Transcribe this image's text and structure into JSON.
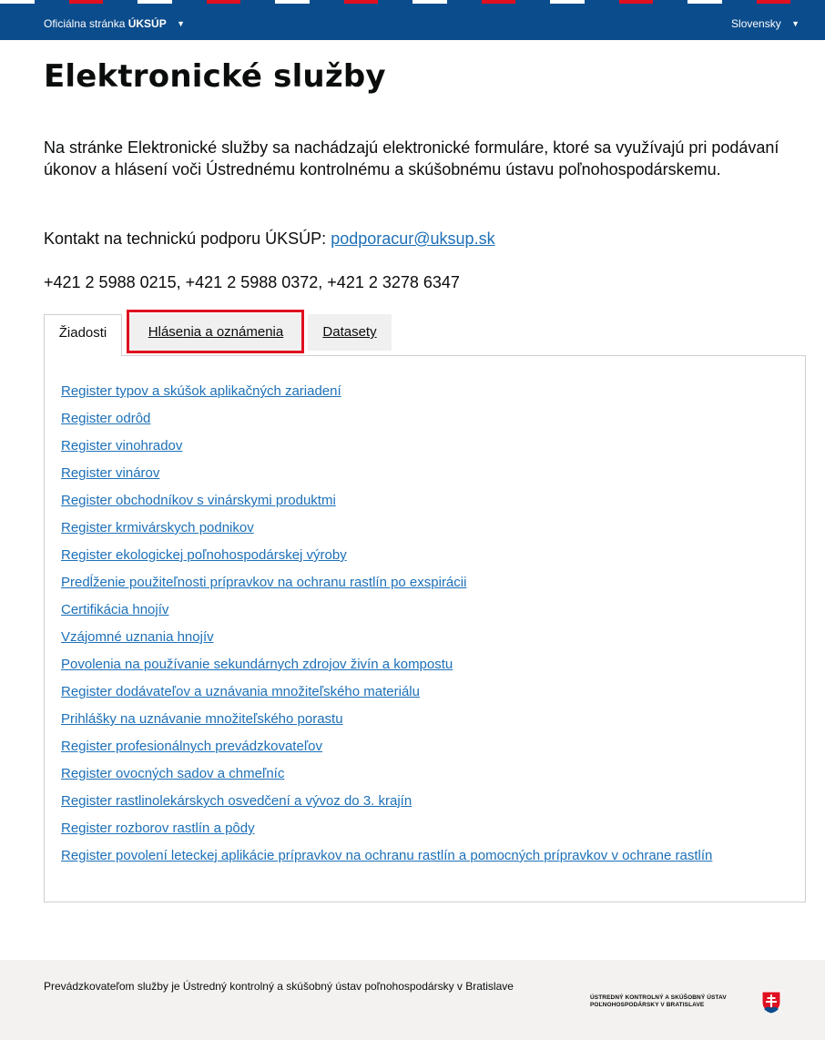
{
  "header": {
    "site_prefix": "Oficiálna stránka",
    "site_name": "ÚKSÚP",
    "language": "Slovensky",
    "caret_glyph": "▼",
    "bar_color": "#0b4c8c",
    "stripe_colors": [
      "#ffffff",
      "#0b4c8c",
      "#e01020",
      "#0b4c8c"
    ]
  },
  "page": {
    "title": "Elektronické služby",
    "intro": "Na stránke Elektronické služby sa nachádzajú elektronické formuláre, ktoré sa využívajú pri podávaní úkonov a hlásení voči Ústrednému kontrolnému a skúšobnému ústavu poľnohospodárskemu.",
    "contact_label": "Kontakt na technickú podporu ÚKSÚP:",
    "contact_email": "podporacur@uksup.sk",
    "phones": "+421 2 5988 0215, +421 2 5988 0372, +421 2 3278 6347"
  },
  "tabs": [
    {
      "label": "Žiadosti",
      "active": true
    },
    {
      "label": "Hlásenia a oznámenia",
      "active": false,
      "highlighted": true
    },
    {
      "label": "Datasety",
      "active": false
    }
  ],
  "links": [
    "Register typov a skúšok aplikačných zariadení",
    "Register odrôd",
    "Register vinohradov",
    "Register vinárov",
    "Register obchodníkov s vinárskymi produktmi",
    "Register krmivárskych podnikov",
    "Register ekologickej poľnohospodárskej výroby",
    "Predĺženie použiteľnosti prípravkov na ochranu rastlín po exspirácii",
    "Certifikácia hnojív",
    "Vzájomné uznania hnojív",
    "Povolenia na používanie sekundárnych zdrojov živín a kompostu",
    "Register dodávateľov a uznávania množiteľského materiálu",
    "Prihlášky na uznávanie množiteľského porastu",
    "Register profesionálnych prevádzkovateľov",
    "Register ovocných sadov a chmeľníc",
    "Register rastlinolekárskych osvedčení a vývoz do 3. krajín",
    "Register rozborov rastlín a pôdy",
    "Register povolení leteckej aplikácie prípravkov na ochranu rastlín a pomocných prípravkov v ochrane rastlín"
  ],
  "footer": {
    "operator_text": "Prevádzkovateľom služby je Ústredný kontrolný a skúšobný ústav poľnohospodársky v Bratislave",
    "logo_line1": "ÚSTREDNÝ KONTROLNÝ A SKÚŠOBNÝ ÚSTAV",
    "logo_line2": "POĽNOHOSPODÁRSKY V BRATISLAVE",
    "emblem_icon": "slovak-coat-of-arms-icon"
  },
  "colors": {
    "link": "#1d70b8",
    "highlight_border": "#e01020",
    "tab_inactive_bg": "#f0f0f0",
    "footer_bg": "#f3f2f1"
  }
}
